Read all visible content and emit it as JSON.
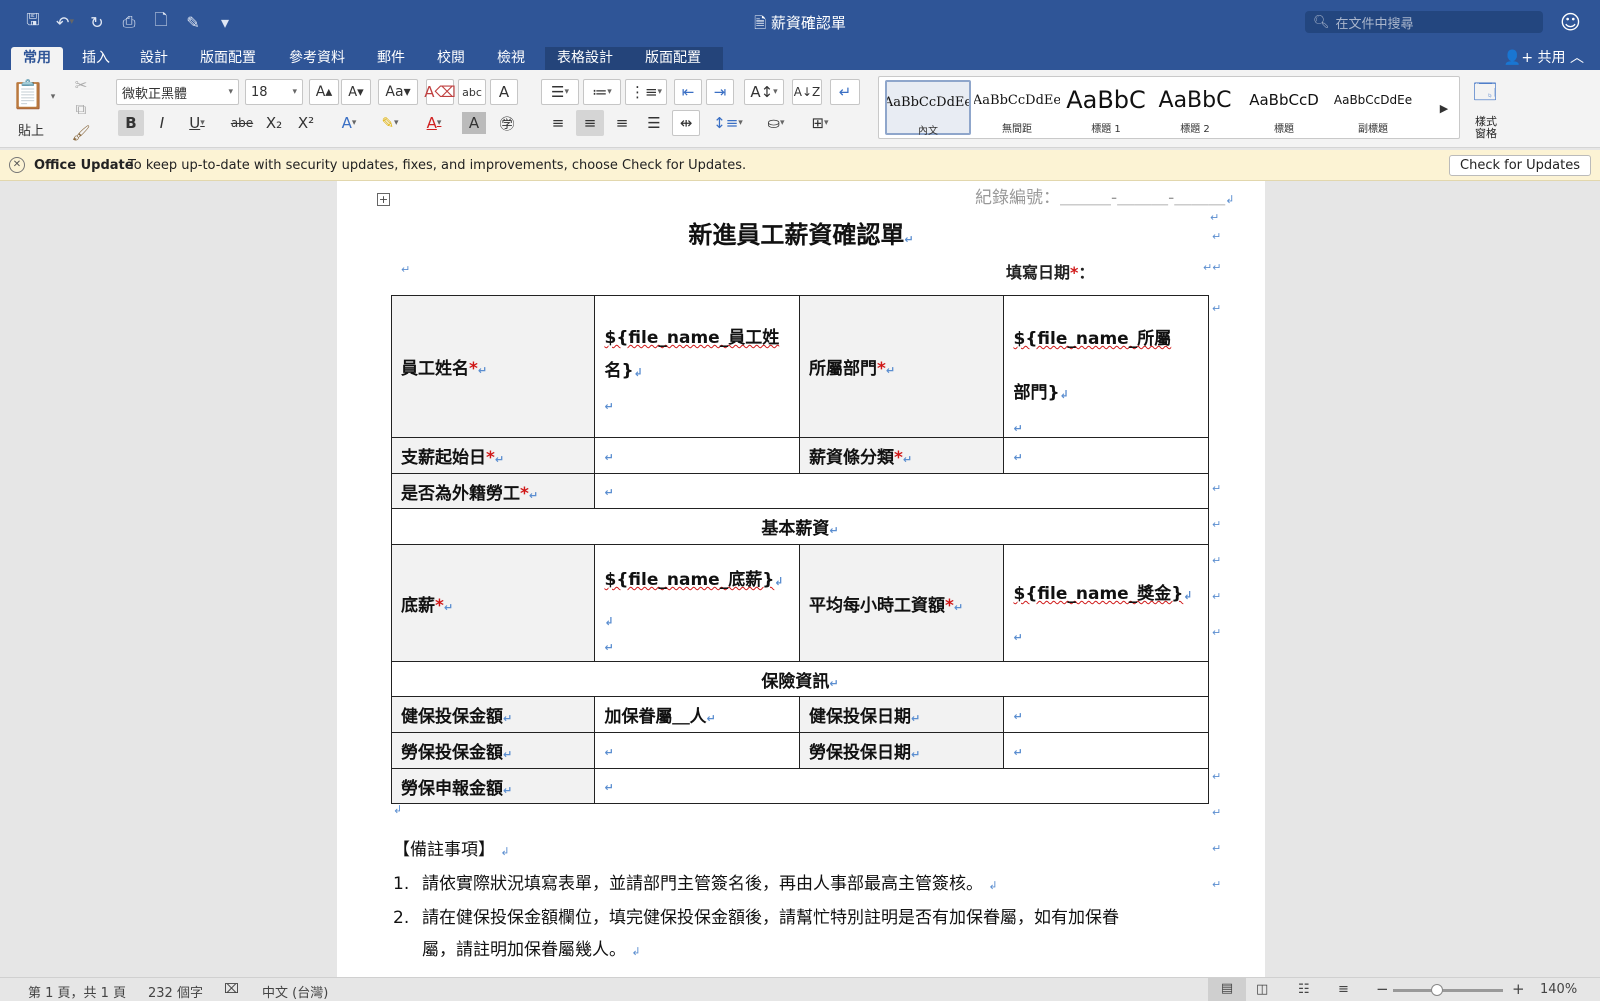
{
  "window": {
    "title": "薪資確認單",
    "search_placeholder": "在文件中搜尋"
  },
  "ribbon_tabs": [
    "常用",
    "插入",
    "設計",
    "版面配置",
    "參考資料",
    "郵件",
    "校閱",
    "檢視",
    "表格設計",
    "版面配置"
  ],
  "share_label": "共用",
  "clipboard": {
    "paste_label": "貼上"
  },
  "font": {
    "name": "微軟正黑體",
    "size": "18"
  },
  "styles": [
    {
      "preview": "AaBbCcDdEe",
      "name": "內文"
    },
    {
      "preview": "AaBbCcDdEe",
      "name": "無間距"
    },
    {
      "preview": "AaBbC",
      "name": "標題 1"
    },
    {
      "preview": "AaBbC",
      "name": "標題 2"
    },
    {
      "preview": "AaBbCcD",
      "name": "標題"
    },
    {
      "preview": "AaBbCcDdEe",
      "name": "副標題"
    }
  ],
  "styles_pane_label": "樣式\n窗格",
  "infobar": {
    "title": "Office Update",
    "message": "To keep up-to-date with security updates, fixes, and improvements, choose Check for Updates.",
    "button": "Check for Updates"
  },
  "document": {
    "record_no": "紀錄編號：＿＿＿-＿＿＿-＿＿＿",
    "title": "新進員工薪資確認單",
    "fill_date": {
      "label": "填寫日期",
      "star": "*",
      "colon": "："
    },
    "table": {
      "employee_name": "員工姓名",
      "employee_name_value_1": "${file_name_員工姓",
      "employee_name_value_2": "名}",
      "department": "所屬部門",
      "department_value_1": "${file_name_所屬",
      "department_value_2": "部門}",
      "pay_start": "支薪起始日",
      "salary_class": "薪資條分類",
      "foreign_worker": "是否為外籍勞工",
      "basic_salary_header": "基本薪資",
      "base_salary": "底薪",
      "base_salary_value": "${file_name_底薪}",
      "avg_hourly": "平均每小時工資額",
      "bonus_value": "${file_name_獎金}",
      "insurance_header": "保險資訊",
      "health_amount": "健保投保金額",
      "dependents": "加保眷屬＿人",
      "health_date": "健保投保日期",
      "labor_amount": "勞保投保金額",
      "labor_date": "勞保投保日期",
      "labor_report": "勞保申報金額",
      "star": "*"
    },
    "notes_title": "【備註事項】",
    "notes": [
      {
        "num": "1.",
        "text": "請依實際狀況填寫表單，並請部門主管簽名後，再由人事部最高主管簽核。"
      },
      {
        "num": "2.",
        "text": "請在健保投保金額欄位，填完健保投保金額後，請幫忙特別註明是否有加保眷屬，如有加保眷",
        "text2": "屬，請註明加保眷屬幾人。"
      }
    ]
  },
  "statusbar": {
    "page": "第 1 頁，共 1 頁",
    "words": "232 個字",
    "language": "中文 (台灣)",
    "zoom": "140%",
    "zoom_level": 0.4
  }
}
